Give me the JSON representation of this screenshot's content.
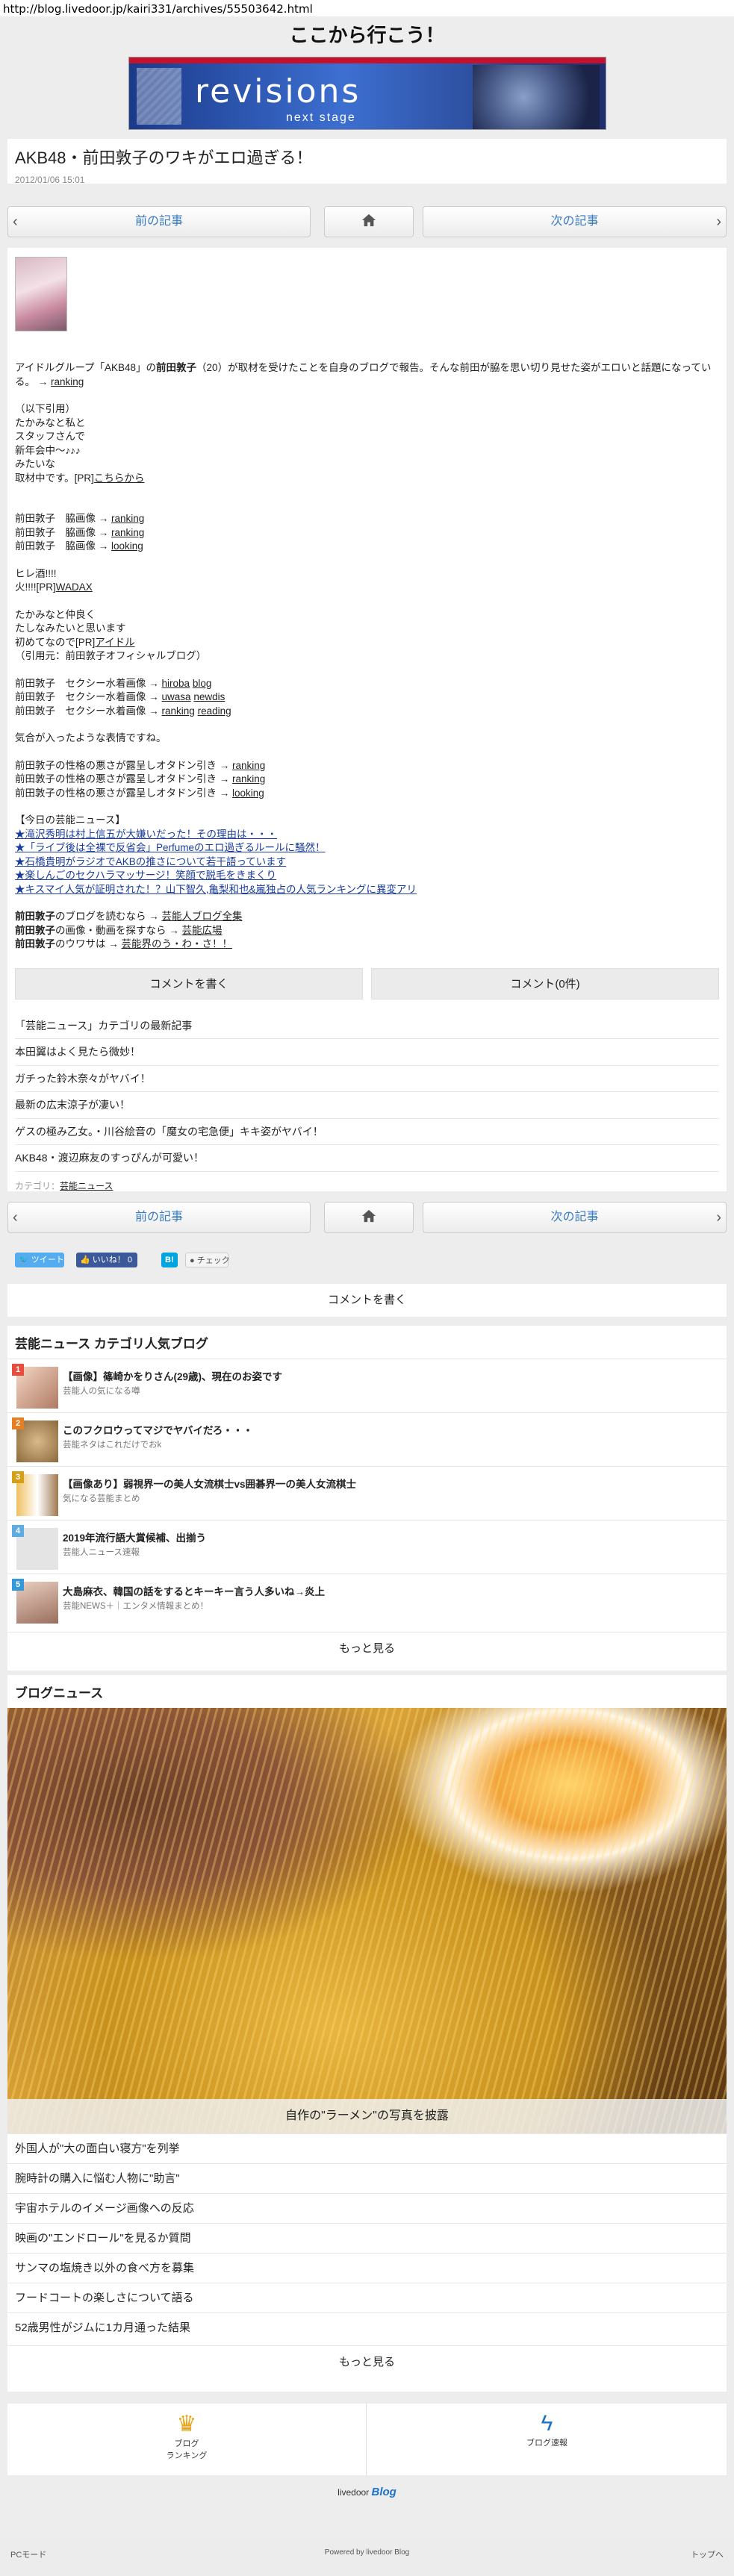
{
  "url": "http://blog.livedoor.jp/kairi331/archives/55503642.html",
  "site_title": "ここから行こう！",
  "banner": {
    "logo": "revisions",
    "sub": "next stage"
  },
  "article": {
    "title": "AKB48・前田敦子のワキがエロ過ぎる！",
    "date": "2012/01/06 15:01"
  },
  "pager": {
    "prev": "前の記事",
    "next": "次の記事"
  },
  "body": {
    "intro_pre": "アイドルグループ「AKB48」の",
    "intro_bold": "前田敦子",
    "intro_post": "（20）が取材を受けたことを自身のブログで報告。そんな前田が脇を思い切り見せた姿がエロいと話題になっている。 →",
    "intro_link": "ranking",
    "quote": [
      "（以下引用）",
      "たかみなと私と",
      "スタッフさんで",
      "新年会中〜♪♪♪",
      "みたいな"
    ],
    "quote_last_pre": "取材中です。[PR]",
    "quote_last_link": "こちらから",
    "armpit_label": "前田敦子　脇画像 →",
    "armpit_links": [
      "ranking",
      "ranking",
      "looking"
    ],
    "hire_pre": "ヒレ酒!!!!",
    "hire2_pre": "火!!!![PR]",
    "hire2_link": "WADAX",
    "lines2": [
      "たかみなと仲良く",
      "たしなみたいと思います"
    ],
    "first_pre": "初めてなので[PR]",
    "first_link": "アイドル",
    "cite": "（引用元：前田敦子オフィシャルブログ）",
    "sexy_label": "前田敦子　セクシー水着画像 →",
    "sexy": [
      [
        "hiroba",
        "blog"
      ],
      [
        "uwasa",
        "newdis"
      ],
      [
        "ranking",
        "reading"
      ]
    ],
    "mood": "気合が入ったような表情ですね。",
    "char_label": "前田敦子の性格の悪さが露呈しオタドン引き →",
    "char_links": [
      "ranking",
      "ranking",
      "looking"
    ],
    "news_head": "【今日の芸能ニュース】",
    "news": [
      "★滝沢秀明は村上信五が大嫌いだった！その理由は・・・",
      "★「ライブ後は全裸で反省会」Perfumeのエロ過ぎるルールに騒然！",
      "★石橋貴明がラジオでAKBの推さについて若干語っています",
      "★楽しんごのセクハラマッサージ！笑顔で脱毛をきまくり",
      "★キスマイ人気が証明された！？山下智久,亀梨和也&嵐独占の人気ランキングに異変アリ"
    ],
    "ext": [
      {
        "pre": "前田敦子",
        "mid": "のブログを読むなら → ",
        "link": "芸能人ブログ全集"
      },
      {
        "pre": "前田敦子",
        "mid": "の画像・動画を探すなら → ",
        "link": "芸能広場"
      },
      {
        "pre": "前田敦子",
        "mid": "のウワサは → ",
        "link": "芸能界のう・わ・さ！！"
      }
    ],
    "comment_write": "コメントを書く",
    "comment_count": "コメント(0件)",
    "cat_title": "「芸能ニュース」カテゴリの最新記事",
    "cat_items": [
      "本田翼はよく見たら微妙！",
      "ガチった鈴木奈々がヤバイ！",
      "最新の広末涼子が凄い！",
      "ゲスの極み乙女。・川谷絵音の「魔女の宅急便」キキ姿がヤバイ！",
      "AKB48・渡辺麻友のすっぴんが可愛い！"
    ],
    "cat_label": "カテゴリ：",
    "cat_link": "芸能ニュース"
  },
  "social": {
    "tweet": "ツイート",
    "like": "いいね！ 0",
    "hatena": "B!",
    "check": "チェック"
  },
  "popular": {
    "title": "芸能ニュース カテゴリ人気ブログ",
    "items": [
      {
        "rank": "1",
        "title": "【画像】篠崎かをりさん(29歳)、現在のお姿です",
        "sub": "芸能人の気になる噂",
        "color": "#e74c3c"
      },
      {
        "rank": "2",
        "title": "このフクロウってマジでヤバイだろ・・・",
        "sub": "芸能ネタはこれだけでおk",
        "color": "#e67e22"
      },
      {
        "rank": "3",
        "title": "【画像あり】弱視界一の美人女流棋士vs囲碁界一の美人女流棋士",
        "sub": "気になる芸能まとめ",
        "color": "#d4a017"
      },
      {
        "rank": "4",
        "title": "2019年流行語大賞候補、出揃う",
        "sub": "芸能人ニュース速報",
        "color": "#5dade2"
      },
      {
        "rank": "5",
        "title": "大島麻衣、韓国の話をするとキーキー言う人多いね→炎上",
        "sub": "芸能NEWS＋｜エンタメ情報まとめ！",
        "color": "#3498db"
      }
    ],
    "more": "もっと見る"
  },
  "blog_news": {
    "title": "ブログニュース",
    "caption": "自作の\"ラーメン\"の写真を披露",
    "items": [
      "外国人が\"大の面白い寝方\"を列挙",
      "腕時計の購入に悩む人物に\"助言\"",
      "宇宙ホテルのイメージ画像への反応",
      "映画の\"エンドロール\"を見るか質問",
      "サンマの塩焼き以外の食べ方を募集",
      "フードコートの楽しさについて語る",
      "52歳男性がジムに1カ月通った結果"
    ],
    "more": "もっと見る"
  },
  "footer": {
    "ranking_label_1": "ブログ",
    "ranking_label_2": "ランキング",
    "speed_label": "ブログ速報",
    "livedoor": "livedoor",
    "blog": "Blog",
    "pc_mode": "PCモード",
    "powered": "Powered by livedoor Blog",
    "top": "トップへ"
  },
  "colors": {
    "link": "#3a7bbf",
    "twitter": "#55acee",
    "facebook": "#3b5998",
    "hatena": "#00a4de",
    "crown": "#e8a317",
    "speed": "#1a73c9"
  }
}
